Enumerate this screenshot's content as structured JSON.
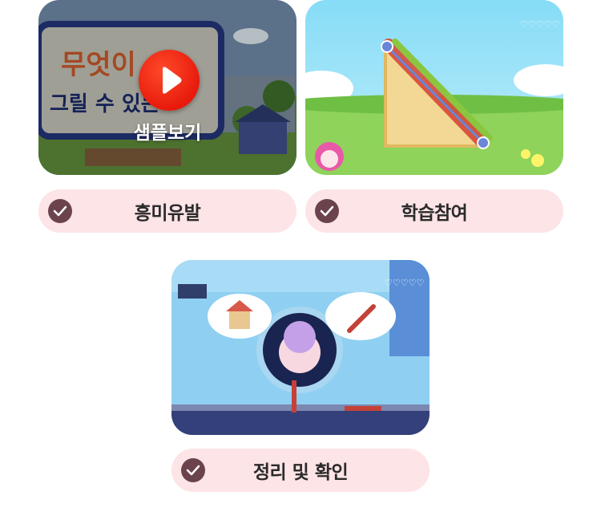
{
  "cards": [
    {
      "label": "흥미유발",
      "play_label": "샘플보기",
      "thumb_text_1": "무엇이",
      "thumb_text_2": "그릴 수 있는 "
    },
    {
      "label": "학습참여"
    },
    {
      "label": "정리 및 확인"
    }
  ],
  "icons": {
    "check": "check-icon",
    "play": "play-icon"
  },
  "colors": {
    "pill_bg": "#fde4e6",
    "check_bg": "#6b434d",
    "play_red": "#e81a0c"
  }
}
